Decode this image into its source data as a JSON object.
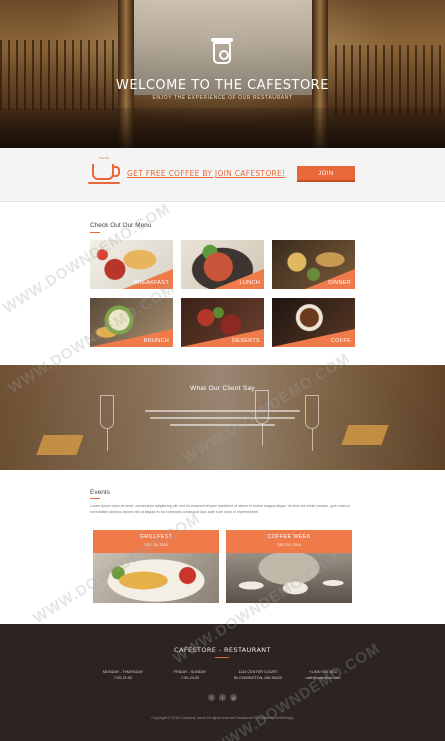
{
  "hero": {
    "title": "WELCOME TO THE CAFESTORE",
    "subtitle": "ENJOY THE EXPERIENCE OF OUR RESTAURANT"
  },
  "promo": {
    "text": "GET FREE COFFEE BY JOIN CAFESTORE!",
    "button": "JOIN"
  },
  "menu": {
    "heading": "Check Out Our Menu",
    "items": [
      {
        "label": "BREAKFAST"
      },
      {
        "label": "LUNCH"
      },
      {
        "label": "DINNER"
      },
      {
        "label": "BRUNCH"
      },
      {
        "label": "DESERTS"
      },
      {
        "label": "COFFE"
      }
    ]
  },
  "testimonials": {
    "heading": "What Our Client Say"
  },
  "events": {
    "heading": "Events",
    "intro": "Lorem ipsum dolor sit amet, consectetur adipisicing elit, sed do eiusmod tempor incididunt ut labore et dolore magna aliqua. Ut enim ad minim veniam, quis nostrud exercitation ullamco laboris nisi ut aliquip ex ea commodo consequat duis aute irure dolor in reprehenderit.",
    "cards": [
      {
        "title": "GRILLFEST",
        "date": "DEC 15, 2015"
      },
      {
        "title": "COFFEE WEEK",
        "date": "DEC 20, 2015"
      }
    ]
  },
  "footer": {
    "title": "CAFESTORE - RESTAURANT",
    "hours_weekday_label": "MONDAY - THURSDAY",
    "hours_weekday": "7:00-21:00",
    "hours_weekend_label": "FRIDAY - SUNDAY",
    "hours_weekend": "7:00-24:00",
    "address_line1": "1115 CENTER COURT",
    "address_line2": "BLOOMINGTON, MN 55425",
    "phone": "+1 800 555 0011",
    "email": "cafe@cafestore.com",
    "social": [
      "f",
      "t",
      "g"
    ],
    "copyright": "Copyright © 2016 Company name All rights reserved Restaurant Template by WebDesign"
  },
  "watermark": "WWW.DOWNDEMO.COM",
  "colors": {
    "accent": "#e8683a",
    "footer_bg": "#2b2421"
  }
}
